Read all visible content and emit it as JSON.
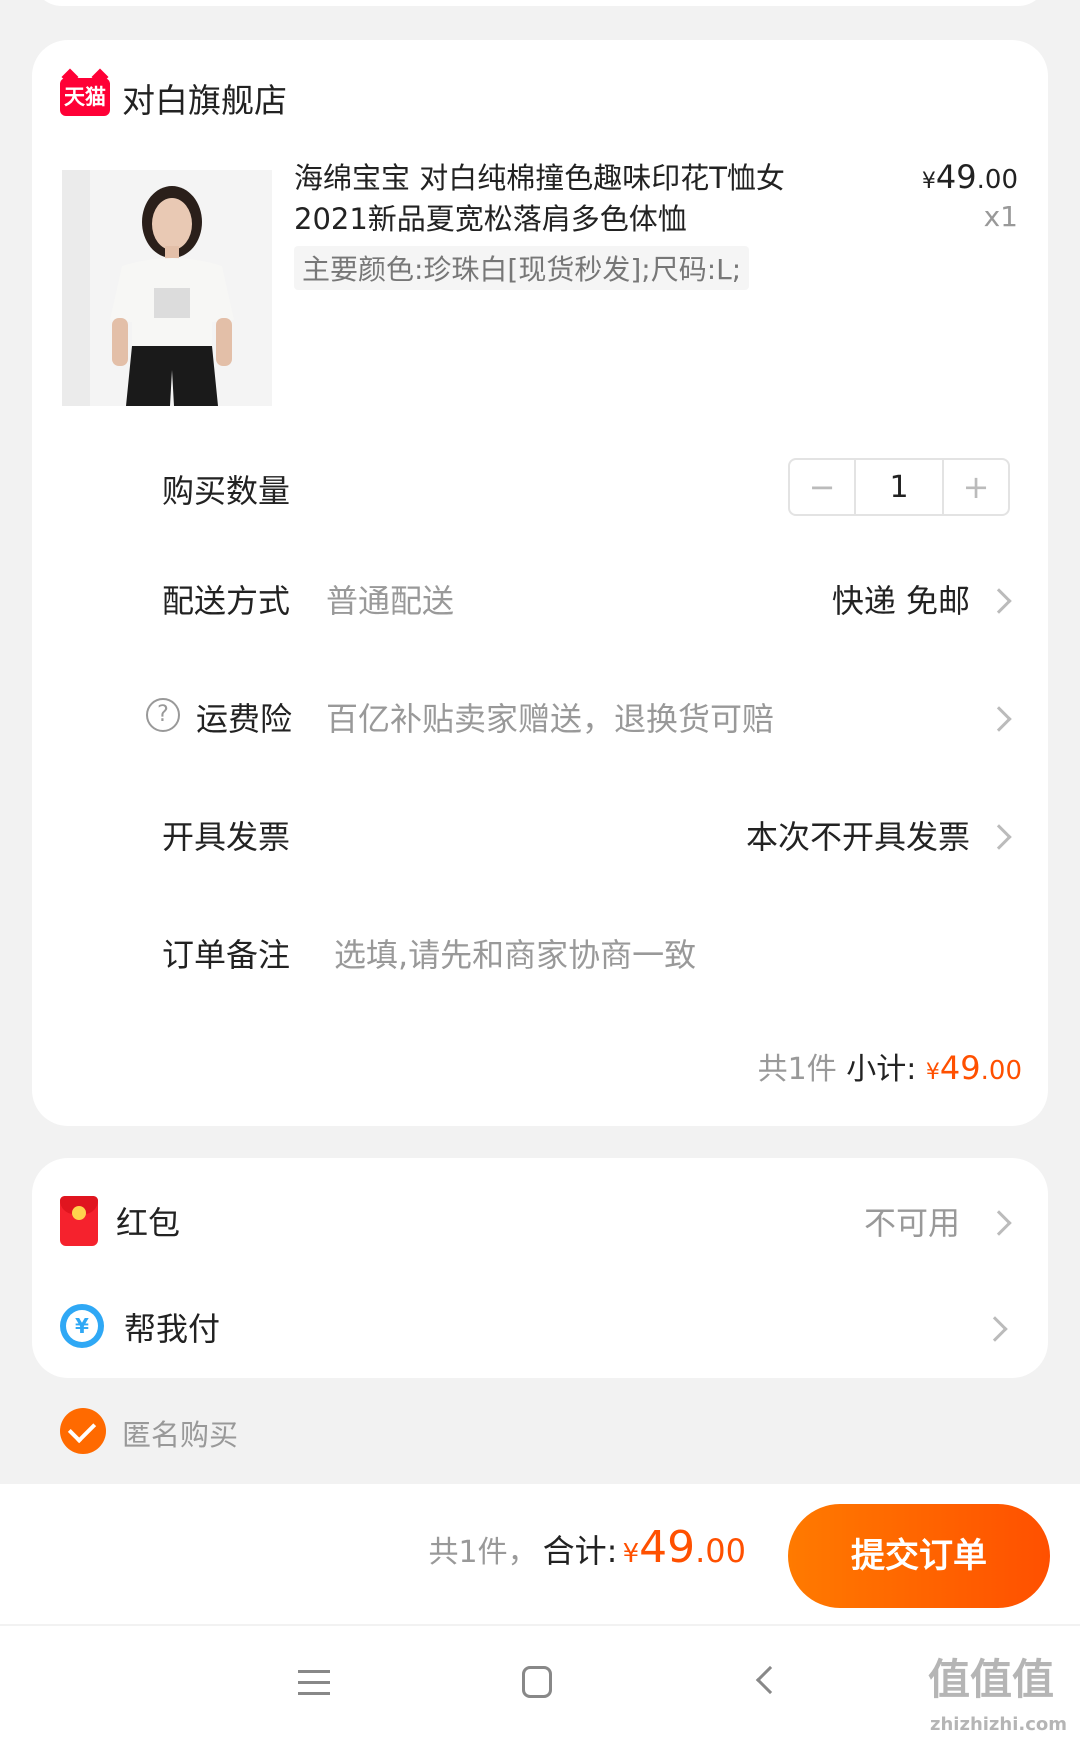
{
  "shop": {
    "badge": "天猫",
    "name": "对白旗舰店"
  },
  "product": {
    "title_line1": "海绵宝宝 对白纯棉撞色趣味印花T恤女",
    "title_line2": "2021新品夏宽松落肩多色体恤",
    "sku": "主要颜色:珍珠白[现货秒发];尺码:L;",
    "currency": "¥",
    "price_int": "49",
    "price_dec": ".00",
    "qty_label": "x1"
  },
  "rows": {
    "quantity_label": "购买数量",
    "quantity_value": "1",
    "minus": "−",
    "plus": "+",
    "delivery_label": "配送方式",
    "delivery_type": "普通配送",
    "delivery_value": "快递 免邮",
    "insurance_icon": "?",
    "insurance_label": "运费险",
    "insurance_value": "百亿补贴卖家赠送，退换货可赔",
    "invoice_label": "开具发票",
    "invoice_value": "本次不开具发票",
    "note_label": "订单备注",
    "note_placeholder": "选填,请先和商家协商一致"
  },
  "subtotal": {
    "count": "共1件",
    "label": "小计:",
    "currency": "¥",
    "int": "49",
    "dec": ".00"
  },
  "extras": {
    "redpacket_label": "红包",
    "redpacket_value": "不可用",
    "helppay_label": "帮我付",
    "helppay_icon_glyph": "¥",
    "anonymous_label": "匿名购买"
  },
  "footer": {
    "count": "共1件，",
    "total_label": "合计:",
    "currency": "¥",
    "int": "49",
    "dec": ".00",
    "submit": "提交订单"
  },
  "watermark": {
    "main": "值值值",
    "sub": "zhizhizhi.com"
  },
  "colors": {
    "accent": "#ff5000",
    "tmall": "#ff0036",
    "redpacket": "#f5222d",
    "helppay": "#2fa8f5"
  },
  "icons": [
    "tmall-icon",
    "question-icon",
    "chevron-right-icon",
    "redpacket-icon",
    "helppay-icon",
    "check-icon",
    "menu-icon",
    "home-icon",
    "back-icon"
  ]
}
